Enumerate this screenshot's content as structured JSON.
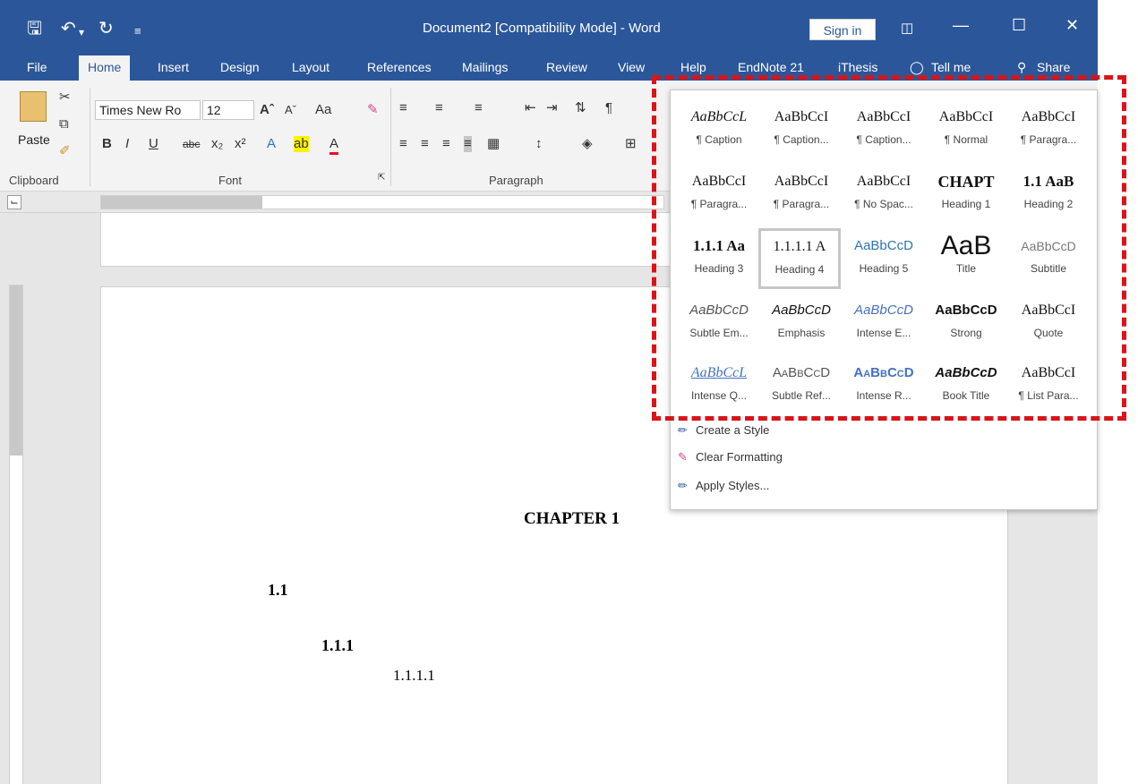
{
  "window": {
    "title": "Document2 [Compatibility Mode]  -  Word",
    "sign_in": "Sign in"
  },
  "tabs": [
    "File",
    "Home",
    "Insert",
    "Design",
    "Layout",
    "References",
    "Mailings",
    "Review",
    "View",
    "Help",
    "EndNote 21",
    "iThesis",
    "Tell me",
    "Share"
  ],
  "ribbon": {
    "font_name": "Times New Ro",
    "font_size": "12",
    "paste_label": "Paste",
    "groups": [
      "Clipboard",
      "Font",
      "Paragraph"
    ],
    "font_row2": [
      "B",
      "I",
      "U",
      "abc",
      "x₂",
      "x²"
    ],
    "change_case": "Aa"
  },
  "styles": [
    {
      "sample": "AaBbCcL",
      "name": "¶ Caption"
    },
    {
      "sample": "AaBbCcI",
      "name": "¶ Caption..."
    },
    {
      "sample": "AaBbCcI",
      "name": "¶ Caption..."
    },
    {
      "sample": "AaBbCcI",
      "name": "¶ Normal"
    },
    {
      "sample": "AaBbCcI",
      "name": "¶ Paragra..."
    },
    {
      "sample": "AaBbCcI",
      "name": "¶ Paragra..."
    },
    {
      "sample": "AaBbCcI",
      "name": "¶ Paragra..."
    },
    {
      "sample": "AaBbCcI",
      "name": "¶ No Spac..."
    },
    {
      "sample": "CHAPT",
      "name": "Heading 1"
    },
    {
      "sample": "1.1 AaB",
      "name": "Heading 2"
    },
    {
      "sample": "1.1.1 Aa",
      "name": "Heading 3"
    },
    {
      "sample": "1.1.1.1 A",
      "name": "Heading 4"
    },
    {
      "sample": "AaBbCcD",
      "name": "Heading 5"
    },
    {
      "sample": "AaB",
      "name": "Title"
    },
    {
      "sample": "AaBbCcD",
      "name": "Subtitle"
    },
    {
      "sample": "AaBbCcD",
      "name": "Subtle Em..."
    },
    {
      "sample": "AaBbCcD",
      "name": "Emphasis"
    },
    {
      "sample": "AaBbCcD",
      "name": "Intense E..."
    },
    {
      "sample": "AaBbCcD",
      "name": "Strong"
    },
    {
      "sample": "AaBbCcI",
      "name": "Quote"
    },
    {
      "sample": "AaBbCcL",
      "name": "Intense Q..."
    },
    {
      "sample": "AaBbCcD",
      "name": "Subtle Ref..."
    },
    {
      "sample": "AaBbCcD",
      "name": "Intense R..."
    },
    {
      "sample": "AaBbCcD",
      "name": "Book Title"
    },
    {
      "sample": "AaBbCcI",
      "name": "¶ List Para..."
    }
  ],
  "selected_style": "Heading 4",
  "gallery_commands": [
    "Create a Style",
    "Clear Formatting",
    "Apply Styles..."
  ],
  "document": {
    "chapter": "CHAPTER 1",
    "h2": "1.1",
    "h3": "1.1.1",
    "h4": "1.1.1.1"
  },
  "colors": {
    "accent": "#2b579a",
    "highlight": "#d9141a"
  }
}
